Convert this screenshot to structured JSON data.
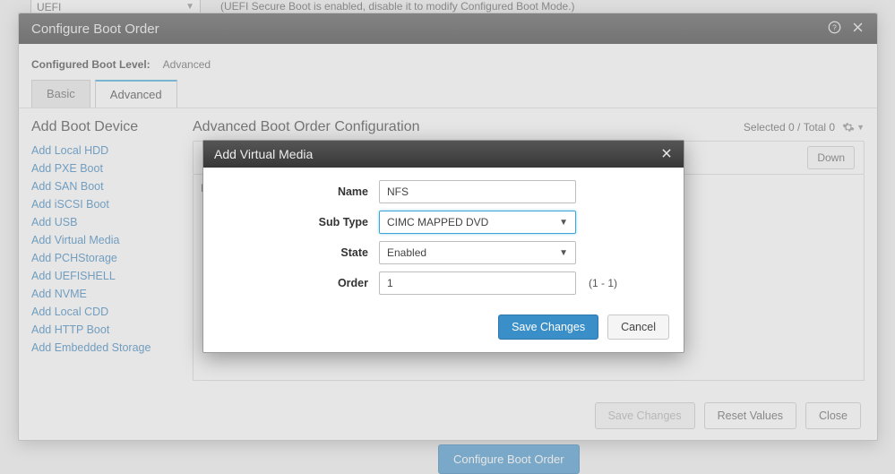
{
  "bg": {
    "uefi_label": "UEFI",
    "note": "(UEFI Secure Boot is enabled, disable it to modify Configured Boot Mode.)"
  },
  "dialog": {
    "title": "Configure Boot Order",
    "level_label": "Configured Boot Level:",
    "level_value": "Advanced",
    "tabs": {
      "basic": "Basic",
      "advanced": "Advanced"
    },
    "sidebar_title": "Add Boot Device",
    "sidebar_items": [
      "Add Local HDD",
      "Add PXE Boot",
      "Add SAN Boot",
      "Add iSCSI Boot",
      "Add USB",
      "Add Virtual Media",
      "Add PCHStorage",
      "Add UEFISHELL",
      "Add NVME",
      "Add Local CDD",
      "Add HTTP Boot",
      "Add Embedded Storage"
    ],
    "content_title": "Advanced Boot Order Configuration",
    "counts": {
      "selected_label": "Selected",
      "selected": "0",
      "sep": "/",
      "total_label": "Total",
      "total": "0"
    },
    "toolbar": {
      "move_down": "Down"
    },
    "table_hint": "N",
    "footer": {
      "save": "Save Changes",
      "reset": "Reset Values",
      "close": "Close"
    },
    "cta": "Configure Boot Order"
  },
  "modal": {
    "title": "Add Virtual Media",
    "fields": {
      "name_label": "Name",
      "name_value": "NFS",
      "subtype_label": "Sub Type",
      "subtype_value": "CIMC MAPPED DVD",
      "state_label": "State",
      "state_value": "Enabled",
      "order_label": "Order",
      "order_value": "1",
      "order_hint": "(1 - 1)"
    },
    "actions": {
      "save": "Save Changes",
      "cancel": "Cancel"
    }
  }
}
